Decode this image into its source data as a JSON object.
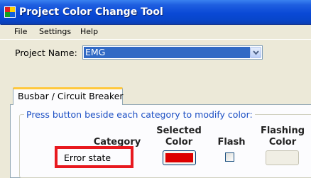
{
  "window": {
    "title": "Project Color Change Tool"
  },
  "menu": {
    "items": [
      "File",
      "Settings",
      "Help"
    ]
  },
  "project": {
    "label": "Project Name:",
    "value": "EMG"
  },
  "tabs": [
    {
      "label": "Busbar / Circuit Breaker"
    }
  ],
  "group": {
    "caption": "Press button beside each category to modify color:"
  },
  "columns": {
    "category": "Category",
    "selected_color": [
      "Selected",
      "Color"
    ],
    "flash": "Flash",
    "flashing_color": [
      "Flashing",
      "Color"
    ]
  },
  "rows": [
    {
      "category": "Error state",
      "selected_color": "#dd0000",
      "flash": false,
      "flashing_color": "#f0eee4"
    }
  ],
  "colors": {
    "highlight": "#e8191f",
    "title_bar": "#0a49d6",
    "selection": "#316ac5"
  },
  "icons": {
    "app": "color-palette-icon",
    "dropdown": "chevron-down-icon"
  }
}
